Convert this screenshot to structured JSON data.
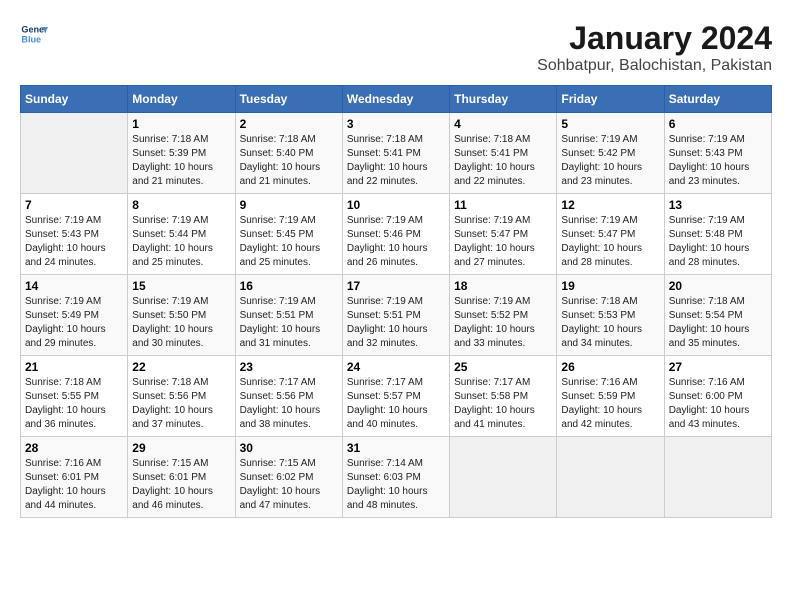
{
  "header": {
    "logo_line1": "General",
    "logo_line2": "Blue",
    "title": "January 2024",
    "subtitle": "Sohbatpur, Balochistan, Pakistan"
  },
  "days_of_week": [
    "Sunday",
    "Monday",
    "Tuesday",
    "Wednesday",
    "Thursday",
    "Friday",
    "Saturday"
  ],
  "weeks": [
    [
      {
        "day": "",
        "info": ""
      },
      {
        "day": "1",
        "info": "Sunrise: 7:18 AM\nSunset: 5:39 PM\nDaylight: 10 hours\nand 21 minutes."
      },
      {
        "day": "2",
        "info": "Sunrise: 7:18 AM\nSunset: 5:40 PM\nDaylight: 10 hours\nand 21 minutes."
      },
      {
        "day": "3",
        "info": "Sunrise: 7:18 AM\nSunset: 5:41 PM\nDaylight: 10 hours\nand 22 minutes."
      },
      {
        "day": "4",
        "info": "Sunrise: 7:18 AM\nSunset: 5:41 PM\nDaylight: 10 hours\nand 22 minutes."
      },
      {
        "day": "5",
        "info": "Sunrise: 7:19 AM\nSunset: 5:42 PM\nDaylight: 10 hours\nand 23 minutes."
      },
      {
        "day": "6",
        "info": "Sunrise: 7:19 AM\nSunset: 5:43 PM\nDaylight: 10 hours\nand 23 minutes."
      }
    ],
    [
      {
        "day": "7",
        "info": "Sunrise: 7:19 AM\nSunset: 5:43 PM\nDaylight: 10 hours\nand 24 minutes."
      },
      {
        "day": "8",
        "info": "Sunrise: 7:19 AM\nSunset: 5:44 PM\nDaylight: 10 hours\nand 25 minutes."
      },
      {
        "day": "9",
        "info": "Sunrise: 7:19 AM\nSunset: 5:45 PM\nDaylight: 10 hours\nand 25 minutes."
      },
      {
        "day": "10",
        "info": "Sunrise: 7:19 AM\nSunset: 5:46 PM\nDaylight: 10 hours\nand 26 minutes."
      },
      {
        "day": "11",
        "info": "Sunrise: 7:19 AM\nSunset: 5:47 PM\nDaylight: 10 hours\nand 27 minutes."
      },
      {
        "day": "12",
        "info": "Sunrise: 7:19 AM\nSunset: 5:47 PM\nDaylight: 10 hours\nand 28 minutes."
      },
      {
        "day": "13",
        "info": "Sunrise: 7:19 AM\nSunset: 5:48 PM\nDaylight: 10 hours\nand 28 minutes."
      }
    ],
    [
      {
        "day": "14",
        "info": "Sunrise: 7:19 AM\nSunset: 5:49 PM\nDaylight: 10 hours\nand 29 minutes."
      },
      {
        "day": "15",
        "info": "Sunrise: 7:19 AM\nSunset: 5:50 PM\nDaylight: 10 hours\nand 30 minutes."
      },
      {
        "day": "16",
        "info": "Sunrise: 7:19 AM\nSunset: 5:51 PM\nDaylight: 10 hours\nand 31 minutes."
      },
      {
        "day": "17",
        "info": "Sunrise: 7:19 AM\nSunset: 5:51 PM\nDaylight: 10 hours\nand 32 minutes."
      },
      {
        "day": "18",
        "info": "Sunrise: 7:19 AM\nSunset: 5:52 PM\nDaylight: 10 hours\nand 33 minutes."
      },
      {
        "day": "19",
        "info": "Sunrise: 7:18 AM\nSunset: 5:53 PM\nDaylight: 10 hours\nand 34 minutes."
      },
      {
        "day": "20",
        "info": "Sunrise: 7:18 AM\nSunset: 5:54 PM\nDaylight: 10 hours\nand 35 minutes."
      }
    ],
    [
      {
        "day": "21",
        "info": "Sunrise: 7:18 AM\nSunset: 5:55 PM\nDaylight: 10 hours\nand 36 minutes."
      },
      {
        "day": "22",
        "info": "Sunrise: 7:18 AM\nSunset: 5:56 PM\nDaylight: 10 hours\nand 37 minutes."
      },
      {
        "day": "23",
        "info": "Sunrise: 7:17 AM\nSunset: 5:56 PM\nDaylight: 10 hours\nand 38 minutes."
      },
      {
        "day": "24",
        "info": "Sunrise: 7:17 AM\nSunset: 5:57 PM\nDaylight: 10 hours\nand 40 minutes."
      },
      {
        "day": "25",
        "info": "Sunrise: 7:17 AM\nSunset: 5:58 PM\nDaylight: 10 hours\nand 41 minutes."
      },
      {
        "day": "26",
        "info": "Sunrise: 7:16 AM\nSunset: 5:59 PM\nDaylight: 10 hours\nand 42 minutes."
      },
      {
        "day": "27",
        "info": "Sunrise: 7:16 AM\nSunset: 6:00 PM\nDaylight: 10 hours\nand 43 minutes."
      }
    ],
    [
      {
        "day": "28",
        "info": "Sunrise: 7:16 AM\nSunset: 6:01 PM\nDaylight: 10 hours\nand 44 minutes."
      },
      {
        "day": "29",
        "info": "Sunrise: 7:15 AM\nSunset: 6:01 PM\nDaylight: 10 hours\nand 46 minutes."
      },
      {
        "day": "30",
        "info": "Sunrise: 7:15 AM\nSunset: 6:02 PM\nDaylight: 10 hours\nand 47 minutes."
      },
      {
        "day": "31",
        "info": "Sunrise: 7:14 AM\nSunset: 6:03 PM\nDaylight: 10 hours\nand 48 minutes."
      },
      {
        "day": "",
        "info": ""
      },
      {
        "day": "",
        "info": ""
      },
      {
        "day": "",
        "info": ""
      }
    ]
  ]
}
